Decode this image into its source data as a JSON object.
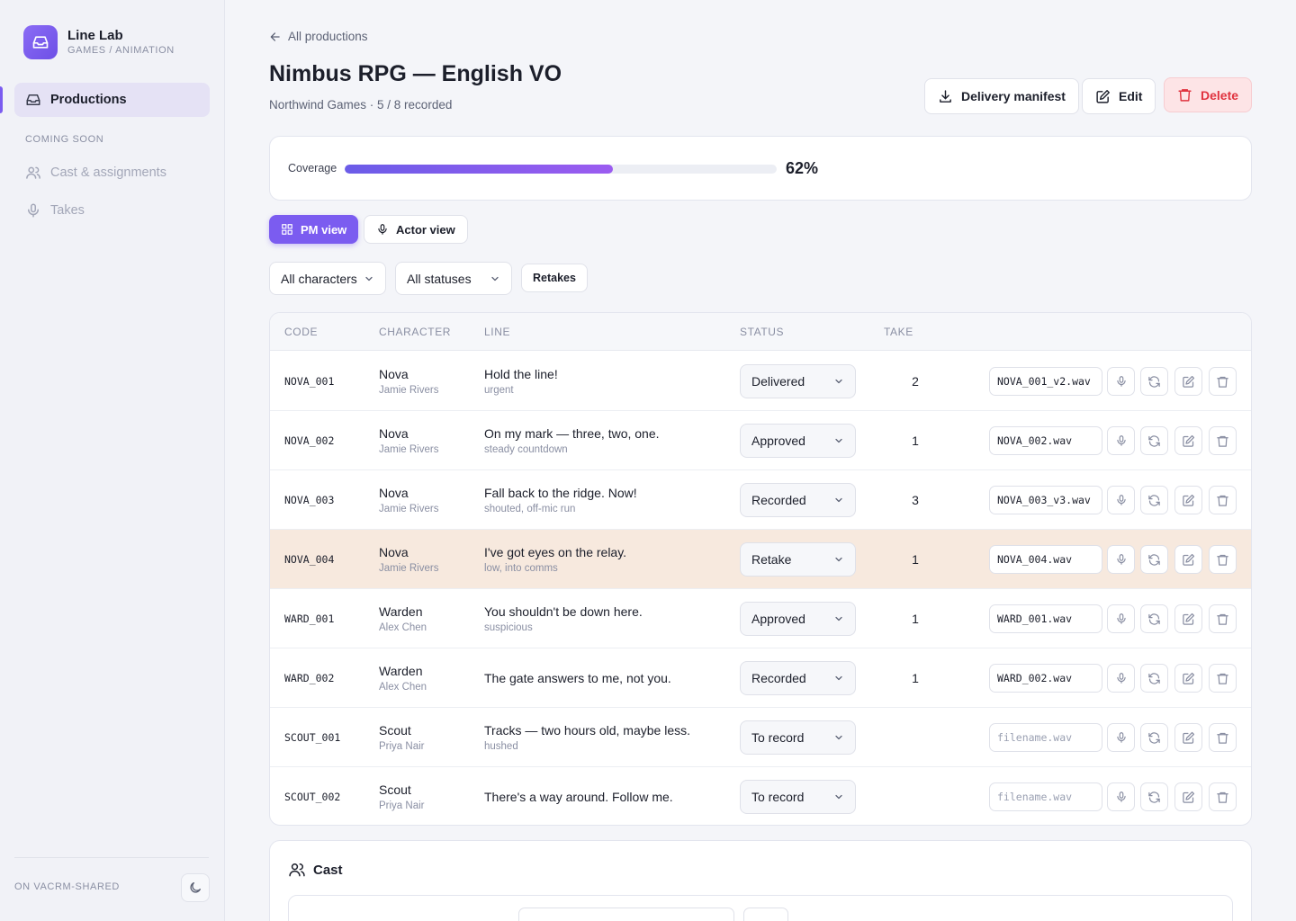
{
  "brand": {
    "name": "Line Lab",
    "subtitle": "GAMES / ANIMATION"
  },
  "sidebar": {
    "active": {
      "label": "Productions",
      "icon": "inbox-icon"
    },
    "section_label": "COMING SOON",
    "items": [
      {
        "label": "Cast & assignments",
        "icon": "users-icon"
      },
      {
        "label": "Takes",
        "icon": "mic-icon"
      }
    ],
    "footer": "ON VACRM-SHARED"
  },
  "header": {
    "back_label": "All productions",
    "title": "Nimbus RPG — English VO",
    "subtitle": "Northwind Games · 5 / 8 recorded",
    "actions": {
      "manifest": "Delivery manifest",
      "edit": "Edit",
      "delete": "Delete"
    }
  },
  "coverage": {
    "label": "Coverage",
    "percent_text": "62%",
    "value": 0.62
  },
  "views": {
    "pm": "PM view",
    "actor": "Actor view"
  },
  "filters": {
    "characters": "All characters",
    "statuses": "All statuses",
    "retakes": "Retakes"
  },
  "table": {
    "headers": {
      "code": "CODE",
      "character": "CHARACTER",
      "line": "LINE",
      "status": "STATUS",
      "take": "TAKE"
    },
    "rows": [
      {
        "code": "NOVA_001",
        "character": "Nova",
        "actor": "Jamie Rivers",
        "line": "Hold the line!",
        "note": "urgent",
        "status": "Delivered",
        "take": "2",
        "file": "NOVA_001_v2.wav",
        "placeholder": "filename.wav"
      },
      {
        "code": "NOVA_002",
        "character": "Nova",
        "actor": "Jamie Rivers",
        "line": "On my mark — three, two, one.",
        "note": "steady countdown",
        "status": "Approved",
        "take": "1",
        "file": "NOVA_002.wav",
        "placeholder": "filename.wav"
      },
      {
        "code": "NOVA_003",
        "character": "Nova",
        "actor": "Jamie Rivers",
        "line": "Fall back to the ridge. Now!",
        "note": "shouted, off-mic run",
        "status": "Recorded",
        "take": "3",
        "file": "NOVA_003_v3.wav",
        "placeholder": "filename.wav"
      },
      {
        "code": "NOVA_004",
        "character": "Nova",
        "actor": "Jamie Rivers",
        "line": "I've got eyes on the relay.",
        "note": "low, into comms",
        "status": "Retake",
        "take": "1",
        "file": "NOVA_004.wav",
        "placeholder": "filename.wav"
      },
      {
        "code": "WARD_001",
        "character": "Warden",
        "actor": "Alex Chen",
        "line": "You shouldn't be down here.",
        "note": "suspicious",
        "status": "Approved",
        "take": "1",
        "file": "WARD_001.wav",
        "placeholder": "filename.wav"
      },
      {
        "code": "WARD_002",
        "character": "Warden",
        "actor": "Alex Chen",
        "line": "The gate answers to me, not you.",
        "note": "",
        "status": "Recorded",
        "take": "1",
        "file": "WARD_002.wav",
        "placeholder": "filename.wav"
      },
      {
        "code": "SCOUT_001",
        "character": "Scout",
        "actor": "Priya Nair",
        "line": "Tracks — two hours old, maybe less.",
        "note": "hushed",
        "status": "To record",
        "take": "",
        "file": "",
        "placeholder": "filename.wav"
      },
      {
        "code": "SCOUT_002",
        "character": "Scout",
        "actor": "Priya Nair",
        "line": "There's a way around. Follow me.",
        "note": "",
        "status": "To record",
        "take": "",
        "file": "",
        "placeholder": "filename.wav"
      }
    ]
  },
  "cast": {
    "title": "Cast"
  },
  "colors": {
    "accent": "#7b5cf0",
    "danger": "#e0333f",
    "retake_row": "#f7e9de"
  }
}
